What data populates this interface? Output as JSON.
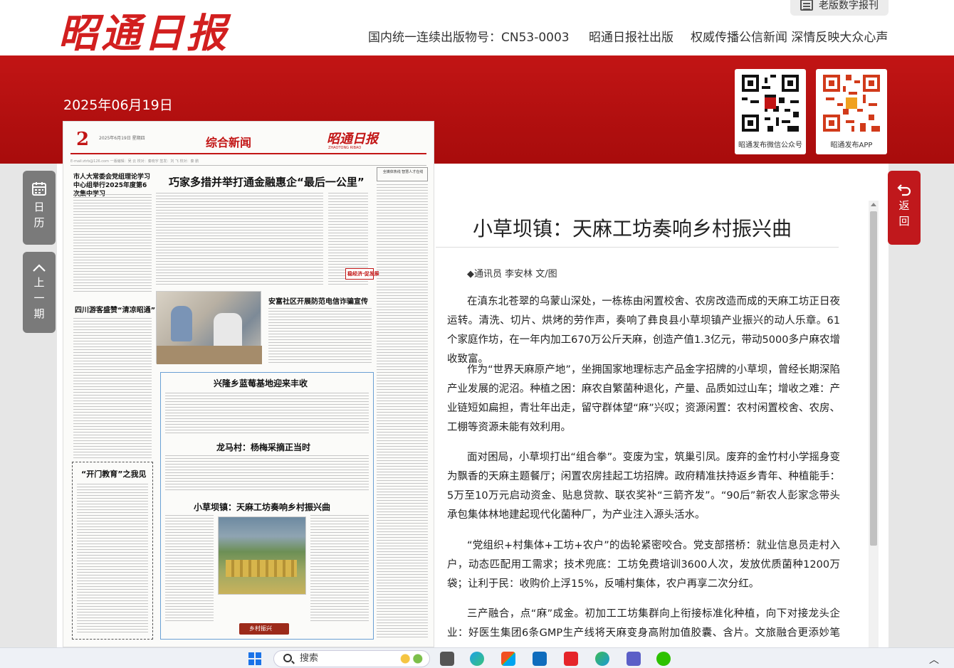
{
  "header": {
    "logo_text": "昭通日报",
    "old_version_label": "老版数字报刊",
    "taglines": [
      "国内统一连续出版物号：CN53-0003",
      "昭通日报社出版",
      "权威传播公信新闻 深情反映大众心声"
    ]
  },
  "edition_date": "2025年06月19日",
  "qr_codes": [
    {
      "label": "昭通发布微信公众号",
      "color": "#111111"
    },
    {
      "label": "昭通发布APP",
      "color": "#d13a1a"
    }
  ],
  "side_nav": {
    "calendar": {
      "label": "日\n历",
      "icon": "calendar-icon"
    },
    "prev_issue": {
      "label": "上\n一\n期",
      "icon": "chevron-up-icon"
    },
    "back": {
      "label": "返\n回",
      "icon": "return-arrow-icon"
    }
  },
  "newspaper_page": {
    "page_number": "2",
    "page_date": "2025年6月19日 星期四",
    "section": "综合新闻",
    "masthead": "昭通日报",
    "masthead_sub": "ZHAOTONG RIBAO",
    "info_line": "E-mail:ztrb@126.com  一版编辑：吴  云  校对：秦晓宇  签发：刘  飞  校对：秦  鹏",
    "headlines": {
      "lead": "巧家多措并举打通金融惠企“最后一公里”",
      "left_top": "市人大常委会党组理论学习中心组举行2025年度第6次集中学习",
      "left_mid": "四川游客盛赞“清凉昭通”",
      "right_top_box": "全媒体热线 智慧人才在线",
      "side_box": "稳经济·促发展",
      "fraud": "安富社区开展防范电信诈骗宣传",
      "blueberry": "兴隆乡蓝莓基地迎来丰收",
      "plum": "龙马村：杨梅采摘正当时",
      "tianma": "小草坝镇：天麻工坊奏响乡村振兴曲",
      "commentary": "“开门教育”之我见",
      "footer_tag": "乡村振兴"
    }
  },
  "article": {
    "title": "小草坝镇：天麻工坊奏响乡村振兴曲",
    "byline": "◆通讯员 李安林 文/图",
    "paragraphs": [
      "在滇东北苍翠的乌蒙山深处，一栋栋由闲置校舍、农房改造而成的天麻工坊正日夜运转。清洗、切片、烘烤的劳作声，奏响了彝良县小草坝镇产业振兴的动人乐章。61个家庭作坊，在一年内加工670万公斤天麻，创造产值1.3亿元，带动5000多户麻农增收致富。",
      "作为“世界天麻原产地”，坐拥国家地理标志产品金字招牌的小草坝，曾经长期深陷产业发展的泥沼。种植之困：麻农自繁菌种退化，产量、品质如过山车；增收之难：产业链短如扁担，青壮年出走，留守群体望“麻”兴叹；资源闲置：农村闲置校舍、农房、工棚等资源未能有效利用。",
      "面对困局，小草坝打出“组合拳”。变废为宝，筑巢引凤。废弃的金竹村小学摇身变为飘香的天麻主题餐厅；闲置农房挂起工坊招牌。政府精准扶持返乡青年、种植能手：5万至10万元启动资金、贴息贷款、联农奖补“三箭齐发”。“90后”新农人彭家念带头承包集体林地建起现代化菌种厂，为产业注入源头活水。",
      "“党组织+村集体+工坊+农户”的齿轮紧密咬合。党支部搭桥：就业信息员走村入户，动态匹配用工需求；技术兜底：工坊免费培训3600人次，发放优质菌种1200万袋；让利于民：收购价上浮15%，反哺村集体，农户再享二次分红。",
      "三产融合，点“麻”成金。初加工工坊集群向上衔接标准化种植，向下对接龙头企业：好医生集团6条GMP生产线将天麻变身高附加值胶囊、含片。文旅融合更添妙笔——"
    ]
  },
  "taskbar": {
    "search_placeholder": "搜索",
    "icons": [
      "windows-start-icon",
      "search-icon",
      "file-explorer-icon",
      "edge-browser-icon",
      "store-icon",
      "outlook-icon",
      "wps-icon",
      "edge-alt-icon",
      "teams-icon",
      "wechat-icon"
    ]
  },
  "colors": {
    "brand_red": "#c21515",
    "side_button_gray": "#7a7a7a",
    "side_button_red": "#c0181c"
  }
}
